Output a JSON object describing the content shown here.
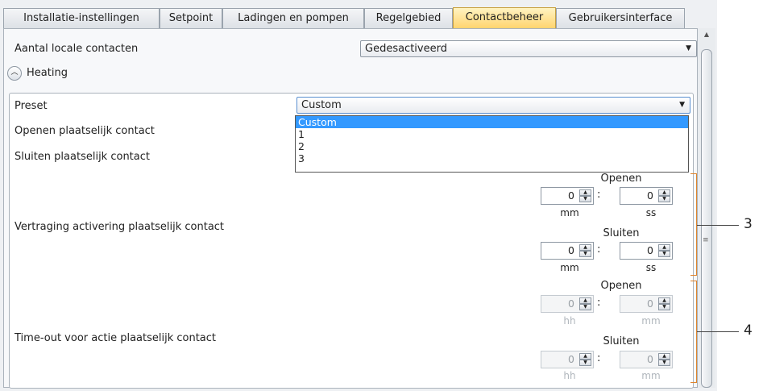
{
  "tabs": [
    {
      "label": "Installatie-instellingen",
      "active": false
    },
    {
      "label": "Setpoint",
      "active": false
    },
    {
      "label": "Ladingen en pompen",
      "active": false
    },
    {
      "label": "Regelgebied",
      "active": false
    },
    {
      "label": "Contactbeheer",
      "active": true
    },
    {
      "label": "Gebruikersinterface",
      "active": false
    }
  ],
  "local_contacts": {
    "label": "Aantal locale contacten",
    "value": "Gedesactiveerd"
  },
  "heating": {
    "header": "Heating",
    "preset": {
      "label": "Preset",
      "value": "Custom",
      "options": [
        "Custom",
        "1",
        "2",
        "3"
      ],
      "selected": "Custom"
    },
    "open_contact_label": "Openen plaatselijk contact",
    "close_contact_label": "Sluiten plaatselijk contact",
    "delay": {
      "label": "Vertraging activering plaatselijk contact",
      "open": {
        "caption": "Openen",
        "a": "0",
        "b": "0",
        "unit_a": "mm",
        "unit_b": "ss"
      },
      "close": {
        "caption": "Sluiten",
        "a": "0",
        "b": "0",
        "unit_a": "mm",
        "unit_b": "ss"
      }
    },
    "timeout": {
      "label": "Time-out voor actie plaatselijk contact",
      "open": {
        "caption": "Openen",
        "a": "0",
        "b": "0",
        "unit_a": "hh",
        "unit_b": "mm"
      },
      "close": {
        "caption": "Sluiten",
        "a": "0",
        "b": "0",
        "unit_a": "hh",
        "unit_b": "mm"
      }
    }
  },
  "callouts": {
    "delay": "3",
    "timeout": "4"
  },
  "colors": {
    "active_tab": "#ffd36b",
    "selection": "#3399ff",
    "callout": "#e0842c"
  }
}
